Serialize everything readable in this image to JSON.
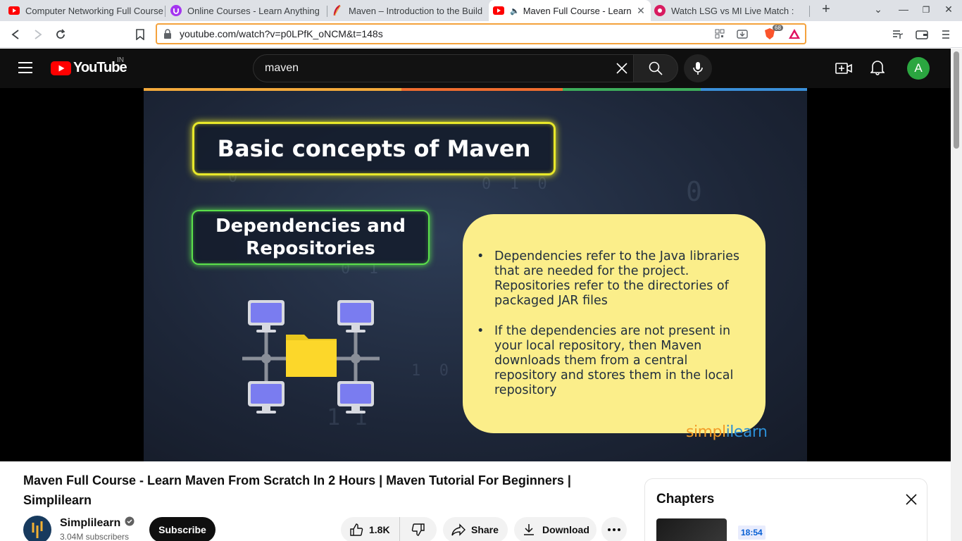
{
  "browser": {
    "tabs": [
      {
        "title": "Computer Networking Full Course",
        "favicon": "youtube-icon"
      },
      {
        "title": "Online Courses - Learn Anything",
        "favicon": "udemy-icon"
      },
      {
        "title": "Maven – Introduction to the Build",
        "favicon": "maven-feather-icon"
      },
      {
        "title": "Maven Full Course - Learn Maven",
        "favicon": "youtube-icon",
        "active": true,
        "audio": true
      },
      {
        "title": "Watch LSG vs MI Live Match :",
        "favicon": "jiocinema-icon"
      }
    ],
    "url": "youtube.com/watch?v=p0LPfK_oNCM&t=148s",
    "brave_shield_count": "68"
  },
  "youtube": {
    "logo_text": "YouTube",
    "region": "IN",
    "search_query": "maven",
    "avatar_letter": "A"
  },
  "slide": {
    "title": "Basic concepts of Maven",
    "subtitle_line1": "Dependencies and",
    "subtitle_line2": "Repositories",
    "bullets": [
      "Dependencies refer to the Java libraries that are needed for the project. Repositories refer to the directories of packaged JAR files",
      "If the dependencies are not present in your local repository, then Maven downloads them from a central repository and stores them in the local repository"
    ],
    "watermark": "simplilearn"
  },
  "video": {
    "title": "Maven Full Course - Learn Maven From Scratch In 2 Hours | Maven Tutorial For Beginners | Simplilearn",
    "channel": "Simplilearn",
    "subscribers": "3.04M subscribers",
    "subscribe_label": "Subscribe",
    "likes": "1.8K",
    "share_label": "Share",
    "download_label": "Download"
  },
  "chapters": {
    "heading": "Chapters",
    "first_timestamp": "18:54"
  },
  "colors": {
    "youtube_red": "#ff0000",
    "dark_bg": "#0f0f0f",
    "card_yellow": "#fbee8a",
    "slide_bg": "#1d2638",
    "title_glow": "#e8e82a",
    "subtitle_glow": "#5be04b",
    "omnibox_border": "#f4a23c",
    "avatar_green": "#2ba640",
    "timestamp_bg": "#e8ecfd",
    "timestamp_fg": "#065fd4"
  }
}
